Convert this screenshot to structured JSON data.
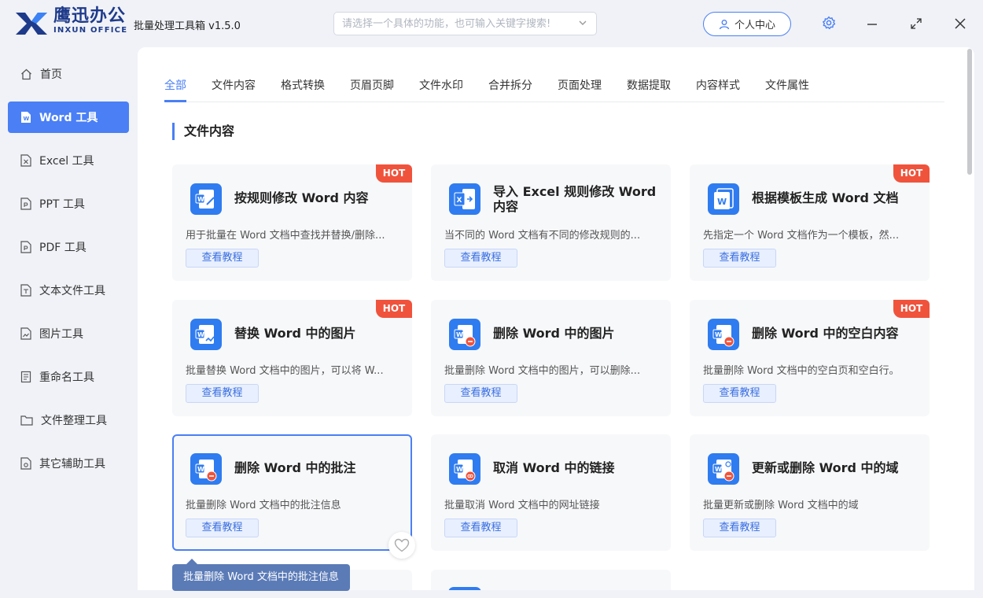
{
  "header": {
    "brand_cn": "鹰迅办公",
    "brand_en": "INXUN OFFICE",
    "app_title": "批量处理工具箱 v1.5.0",
    "search_placeholder": "请选择一个具体的功能，也可输入关键字搜索!",
    "user_center": "个人中心"
  },
  "sidebar": {
    "items": [
      {
        "label": "首页",
        "icon": "home-icon"
      },
      {
        "label": "Word 工具",
        "icon": "word-file-icon",
        "active": true
      },
      {
        "label": "Excel 工具",
        "icon": "excel-file-icon"
      },
      {
        "label": "PPT 工具",
        "icon": "ppt-file-icon"
      },
      {
        "label": "PDF 工具",
        "icon": "pdf-file-icon"
      },
      {
        "label": "文本文件工具",
        "icon": "text-file-icon"
      },
      {
        "label": "图片工具",
        "icon": "image-file-icon"
      },
      {
        "label": "重命名工具",
        "icon": "rename-icon"
      },
      {
        "label": "文件整理工具",
        "icon": "folder-icon"
      },
      {
        "label": "其它辅助工具",
        "icon": "tools-icon"
      }
    ]
  },
  "tabs": [
    {
      "label": "全部",
      "active": true
    },
    {
      "label": "文件内容"
    },
    {
      "label": "格式转换"
    },
    {
      "label": "页眉页脚"
    },
    {
      "label": "文件水印"
    },
    {
      "label": "合并拆分"
    },
    {
      "label": "页面处理"
    },
    {
      "label": "数据提取"
    },
    {
      "label": "内容样式"
    },
    {
      "label": "文件属性"
    }
  ],
  "section_title": "文件内容",
  "cards": [
    {
      "title": "按规则修改 Word 内容",
      "desc": "用于批量在 Word 文档中查找并替换/删除...",
      "button": "查看教程",
      "hot": "HOT",
      "icon": "word-edit-icon"
    },
    {
      "title": "导入 Excel 规则修改 Word 内容",
      "desc": "当不同的 Word 文档有不同的修改规则的...",
      "button": "查看教程",
      "hot": "",
      "icon": "excel-to-word-icon"
    },
    {
      "title": "根据模板生成 Word 文档",
      "desc": "先指定一个 Word 文档作为一个模板，然...",
      "button": "查看教程",
      "hot": "HOT",
      "icon": "word-template-icon"
    },
    {
      "title": "替换 Word 中的图片",
      "desc": "批量替换 Word 文档中的图片，可以将 W...",
      "button": "查看教程",
      "hot": "HOT",
      "icon": "word-replace-image-icon"
    },
    {
      "title": "删除 Word 中的图片",
      "desc": "批量删除 Word 文档中的图片，可以删除...",
      "button": "查看教程",
      "hot": "",
      "icon": "word-delete-image-icon"
    },
    {
      "title": "删除 Word 中的空白内容",
      "desc": "批量删除 Word 文档中的空白页和空白行。",
      "button": "查看教程",
      "hot": "HOT",
      "icon": "word-delete-blank-icon"
    },
    {
      "title": "删除 Word 中的批注",
      "desc": "批量删除 Word 文档中的批注信息",
      "button": "查看教程",
      "hot": "",
      "icon": "word-delete-comment-icon"
    },
    {
      "title": "取消 Word 中的链接",
      "desc": "批量取消 Word 文档中的网址链接",
      "button": "查看教程",
      "hot": "",
      "icon": "word-unlink-icon"
    },
    {
      "title": "更新或删除 Word 中的域",
      "desc": "批量更新或删除 Word 文档中的域",
      "button": "查看教程",
      "hot": "",
      "icon": "word-field-icon"
    }
  ],
  "tooltip": "批量删除 Word 文档中的批注信息",
  "colors": {
    "accent": "#4a7ff5",
    "hot": "#f0533c",
    "brand": "#1e3a8a"
  }
}
